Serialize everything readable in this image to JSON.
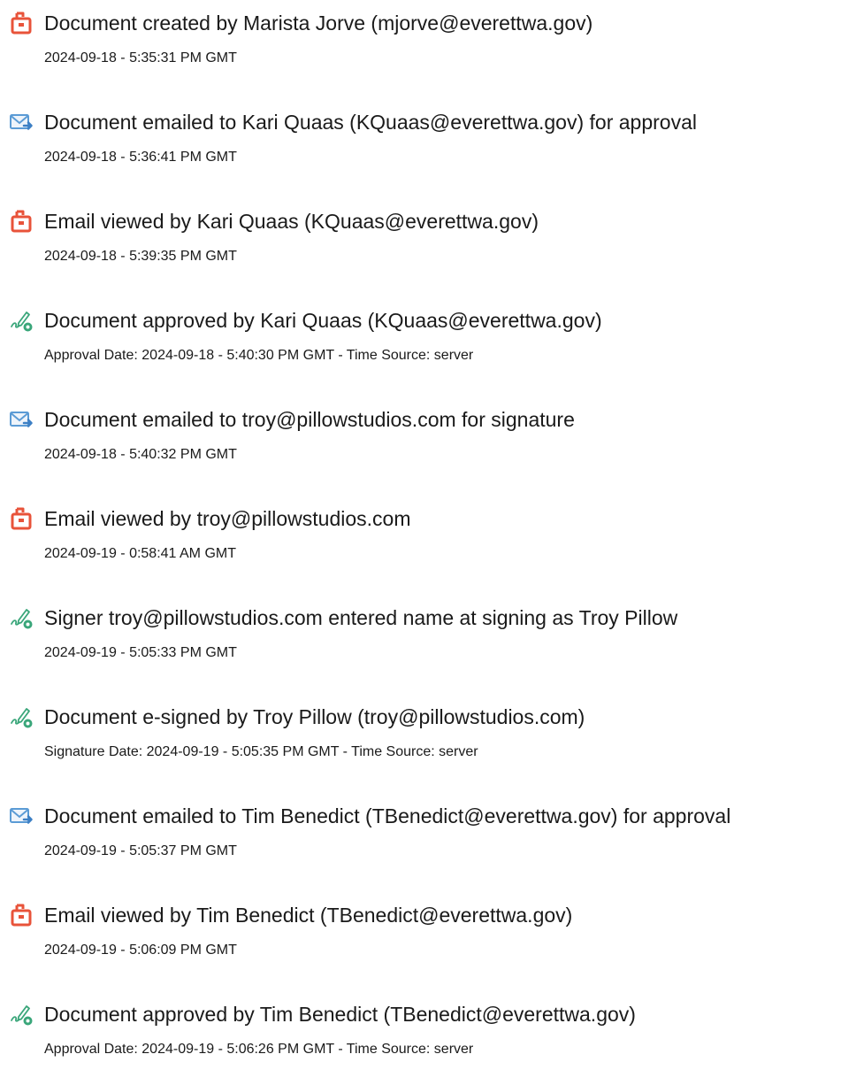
{
  "history": {
    "events": [
      {
        "icon": "document-created-icon",
        "title": "Document created by Marista Jorve (mjorve@everettwa.gov)",
        "detail": "2024-09-18 - 5:35:31 PM GMT"
      },
      {
        "icon": "email-sent-icon",
        "title": "Document emailed to Kari Quaas (KQuaas@everettwa.gov) for approval",
        "detail": "2024-09-18 - 5:36:41 PM GMT"
      },
      {
        "icon": "document-viewed-icon",
        "title": "Email viewed by Kari Quaas (KQuaas@everettwa.gov)",
        "detail": "2024-09-18 - 5:39:35 PM GMT"
      },
      {
        "icon": "signature-pen-icon",
        "title": "Document approved by Kari Quaas (KQuaas@everettwa.gov)",
        "detail": "Approval Date: 2024-09-18 - 5:40:30 PM GMT - Time Source: server"
      },
      {
        "icon": "email-sent-icon",
        "title": "Document emailed to troy@pillowstudios.com for signature",
        "detail": "2024-09-18 - 5:40:32 PM GMT"
      },
      {
        "icon": "document-viewed-icon",
        "title": "Email viewed by troy@pillowstudios.com",
        "detail": "2024-09-19 - 0:58:41 AM GMT"
      },
      {
        "icon": "signature-pen-icon",
        "title": "Signer troy@pillowstudios.com entered name at signing as Troy Pillow",
        "detail": "2024-09-19 - 5:05:33 PM GMT"
      },
      {
        "icon": "signature-pen-icon",
        "title": "Document e-signed by Troy Pillow (troy@pillowstudios.com)",
        "detail": "Signature Date: 2024-09-19 - 5:05:35 PM GMT - Time Source: server"
      },
      {
        "icon": "email-sent-icon",
        "title": "Document emailed to Tim Benedict (TBenedict@everettwa.gov) for approval",
        "detail": "2024-09-19 - 5:05:37 PM GMT"
      },
      {
        "icon": "document-viewed-icon",
        "title": "Email viewed by Tim Benedict (TBenedict@everettwa.gov)",
        "detail": "2024-09-19 - 5:06:09 PM GMT"
      },
      {
        "icon": "signature-pen-icon",
        "title": "Document approved by Tim Benedict (TBenedict@everettwa.gov)",
        "detail": "Approval Date: 2024-09-19 - 5:06:26 PM GMT - Time Source: server"
      }
    ]
  },
  "colors": {
    "document_icon": "#e8533a",
    "email_icon": "#5b9bd5",
    "pen_icon": "#3aa67a"
  }
}
